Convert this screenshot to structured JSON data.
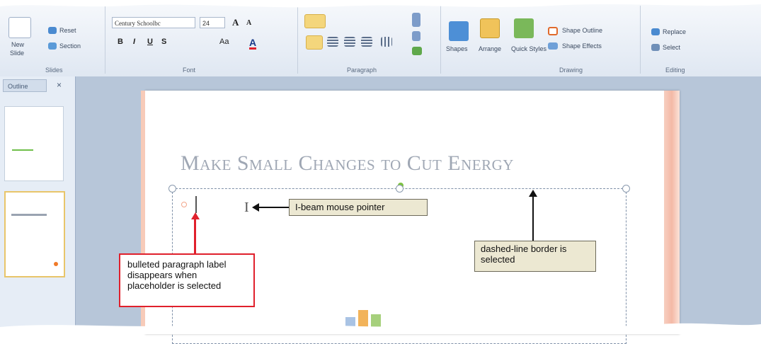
{
  "ribbon": {
    "slides_group": {
      "reset": "Reset",
      "section": "Section",
      "new": "New",
      "slide": "Slide",
      "label": "Slides"
    },
    "font_group": {
      "font_name": "Century Schoolbc",
      "font_size": "24",
      "label": "Font",
      "bold": "B",
      "italic": "I",
      "underline": "U",
      "strike": "S",
      "change_case": "Aa",
      "font_color": "A",
      "grow": "A",
      "shrink": "A"
    },
    "paragraph_group": {
      "label": "Paragraph"
    },
    "drawing_group": {
      "shapes": "Shapes",
      "arrange": "Arrange",
      "quick_styles": "Quick Styles",
      "shape_outline": "Shape Outline",
      "shape_effects": "Shape Effects",
      "label": "Drawing"
    },
    "editing_group": {
      "replace": "Replace",
      "select": "Select",
      "label": "Editing"
    }
  },
  "left_pane": {
    "tab": "Outline",
    "close": "×"
  },
  "slide": {
    "title": "Make Small Changes to Cut Energy"
  },
  "callouts": {
    "ibeam": "I-beam mouse pointer",
    "dashed": "dashed-line border is selected",
    "bullet": "bulleted paragraph label disappears when placeholder is selected"
  },
  "colors": {
    "accent_red": "#e0202c",
    "callout_fill": "#ece8d2",
    "slide_stripe": "#f4b9a6"
  }
}
